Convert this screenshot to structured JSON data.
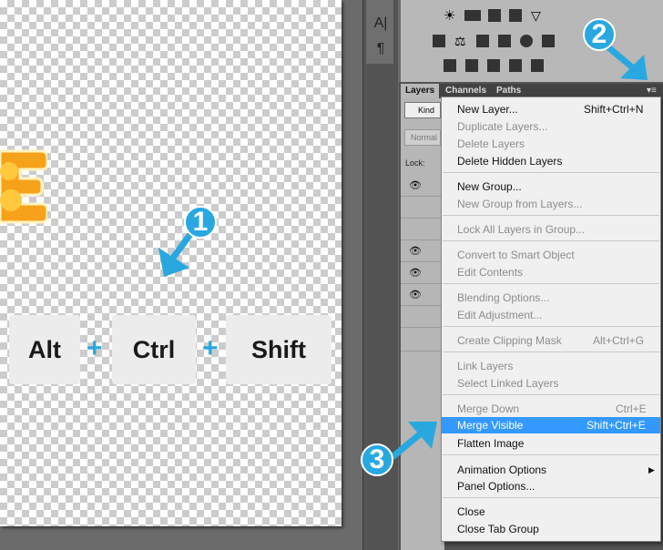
{
  "canvas": {
    "keys": [
      "Alt",
      "Ctrl",
      "Shift"
    ],
    "plus": "+",
    "badges": [
      "1",
      "2",
      "3"
    ]
  },
  "tools": {
    "type_tool": "A|",
    "paragraph_tool": "¶"
  },
  "tabs": [
    "Layers",
    "Channels",
    "Paths"
  ],
  "layers": {
    "kind_filter": "Kind",
    "blend_mode": "Normal",
    "lock_label": "Lock:"
  },
  "menu": {
    "items": [
      {
        "label": "New Layer...",
        "shortcut": "Shift+Ctrl+N",
        "enabled": true
      },
      {
        "label": "Duplicate Layers...",
        "shortcut": "",
        "enabled": false
      },
      {
        "label": "Delete Layers",
        "shortcut": "",
        "enabled": false
      },
      {
        "label": "Delete Hidden Layers",
        "shortcut": "",
        "enabled": true
      },
      {
        "label": "New Group...",
        "shortcut": "",
        "enabled": true
      },
      {
        "label": "New Group from Layers...",
        "shortcut": "",
        "enabled": false
      },
      {
        "label": "Lock All Layers in Group...",
        "shortcut": "",
        "enabled": false
      },
      {
        "label": "Convert to Smart Object",
        "shortcut": "",
        "enabled": false
      },
      {
        "label": "Edit Contents",
        "shortcut": "",
        "enabled": false
      },
      {
        "label": "Blending Options...",
        "shortcut": "",
        "enabled": false
      },
      {
        "label": "Edit Adjustment...",
        "shortcut": "",
        "enabled": false
      },
      {
        "label": "Create Clipping Mask",
        "shortcut": "Alt+Ctrl+G",
        "enabled": false
      },
      {
        "label": "Link Layers",
        "shortcut": "",
        "enabled": false
      },
      {
        "label": "Select Linked Layers",
        "shortcut": "",
        "enabled": false
      },
      {
        "label": "Merge Down",
        "shortcut": "Ctrl+E",
        "enabled": false
      },
      {
        "label": "Merge Visible",
        "shortcut": "Shift+Ctrl+E",
        "enabled": true,
        "highlighted": true
      },
      {
        "label": "Flatten Image",
        "shortcut": "",
        "enabled": true
      },
      {
        "label": "Animation Options",
        "shortcut": "",
        "enabled": true,
        "submenu": true
      },
      {
        "label": "Panel Options...",
        "shortcut": "",
        "enabled": true
      },
      {
        "label": "Close",
        "shortcut": "",
        "enabled": true
      },
      {
        "label": "Close Tab Group",
        "shortcut": "",
        "enabled": true
      }
    ]
  },
  "colors": {
    "accent": "#29a8e0",
    "highlight": "#3399ff",
    "menu_bg": "#f0f0f0"
  }
}
